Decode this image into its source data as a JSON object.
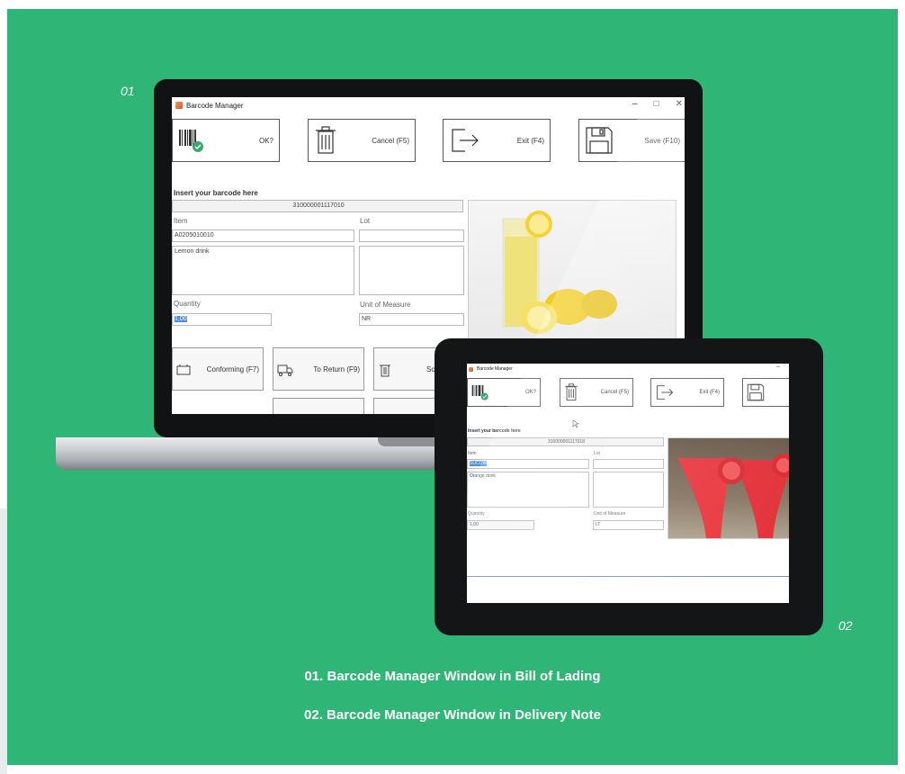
{
  "labels": {
    "first": "01",
    "second": "02"
  },
  "captions": {
    "line1": "01. Barcode Manager Window in Bill of Lading",
    "line2": "02. Barcode Manager Window in Delivery Note"
  },
  "laptop_window": {
    "title": "Barcode Manager",
    "controls": {
      "minimize": "–",
      "maximize": "□",
      "close": "✕"
    },
    "toolbar": {
      "ok": "OK?",
      "cancel": "Cancel (F5)",
      "exit": "Exit (F4)",
      "save": "Save (F10)"
    },
    "barcode_header": "Insert your barcode here",
    "barcode_value": "310000001117010",
    "item_label": "Item",
    "item_value": "A0205010010",
    "description_value": "Lemon drink",
    "lot_label": "Lot",
    "lot_value": "",
    "quantity_label": "Quantity",
    "quantity_value": "1,00",
    "uom_label": "Unit of Measure",
    "uom_value": "NR",
    "actions": {
      "conforming": "Conforming (F7)",
      "to_return": "To Return (F9)",
      "scrap": "Scr"
    }
  },
  "tablet_window": {
    "title": "Barcode Manager",
    "controls": {
      "minimize": "–"
    },
    "toolbar": {
      "ok": "OK?",
      "cancel": "Cancel (F5)",
      "exit": "Exit (F4)"
    },
    "barcode_header": "Insert your barcode here",
    "barcode_value": "310000001117018",
    "item_label": "Item",
    "item_value": "SUCOW",
    "description_value": "Orange drink",
    "lot_label": "Lot",
    "lot_value": "",
    "quantity_label": "Quantity",
    "quantity_value": "1,00",
    "uom_label": "Unit of Measure",
    "uom_value": "LT"
  },
  "colors": {
    "background": "#2fb575",
    "bezel": "#111213",
    "text_on_green": "#ffffff"
  }
}
